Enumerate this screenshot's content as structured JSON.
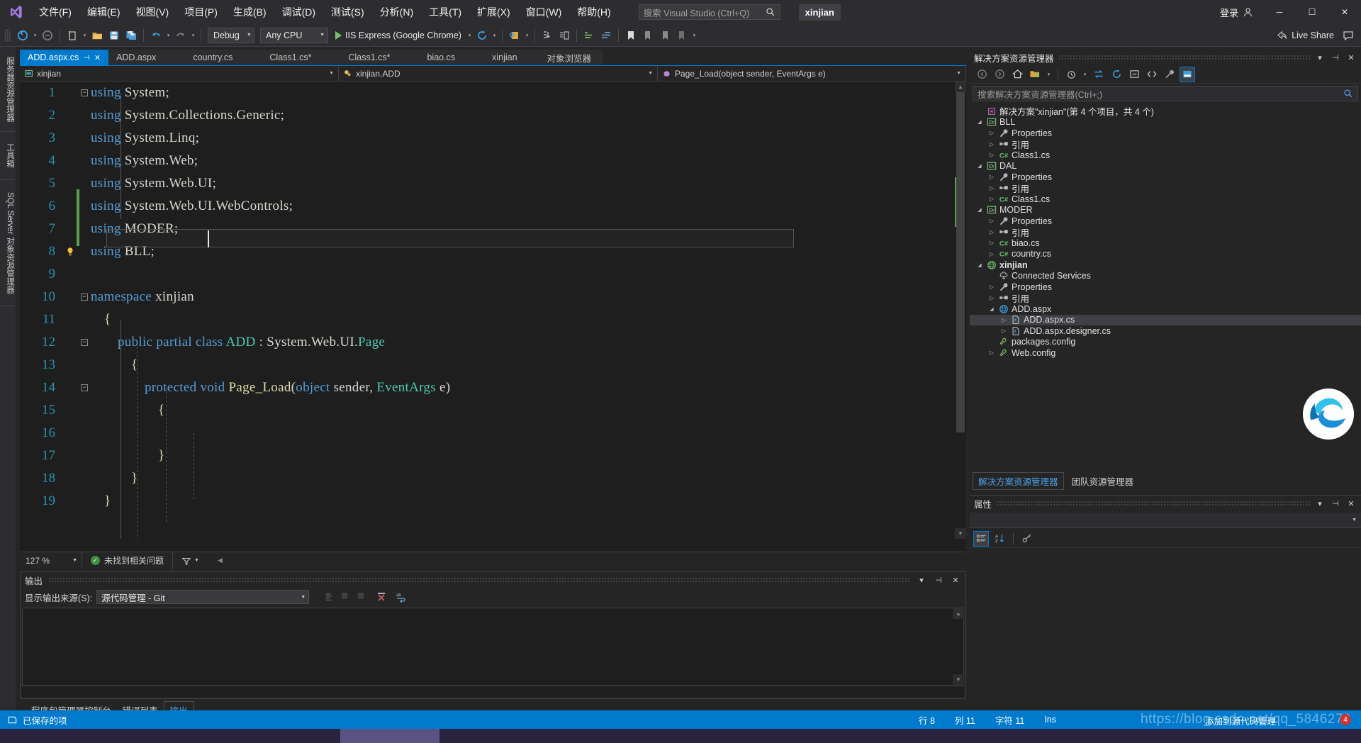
{
  "window": {
    "title": "xinjian",
    "menus": [
      {
        "label": "文件(F)"
      },
      {
        "label": "编辑(E)"
      },
      {
        "label": "视图(V)"
      },
      {
        "label": "项目(P)"
      },
      {
        "label": "生成(B)"
      },
      {
        "label": "调试(D)"
      },
      {
        "label": "测试(S)"
      },
      {
        "label": "分析(N)"
      },
      {
        "label": "工具(T)"
      },
      {
        "label": "扩展(X)"
      },
      {
        "label": "窗口(W)"
      },
      {
        "label": "帮助(H)"
      }
    ],
    "search_placeholder": "搜索 Visual Studio (Ctrl+Q)",
    "signin_label": "登录",
    "minimize": "─",
    "maximize": "☐",
    "close": "✕"
  },
  "toolbar": {
    "config_value": "Debug",
    "platform_value": "Any CPU",
    "run_label": "IIS Express (Google Chrome)",
    "liveshare_label": "Live Share"
  },
  "left_rail": [
    {
      "label": "服务器资源管理器"
    },
    {
      "label": "工具箱"
    },
    {
      "label": "SQL Server 对象资源管理器"
    }
  ],
  "editor": {
    "tabs": [
      {
        "label": "ADD.aspx.cs",
        "active": true,
        "pin": "⊣",
        "close": "✕"
      },
      {
        "label": "ADD.aspx",
        "active": false
      },
      {
        "label": "country.cs",
        "active": false
      },
      {
        "label": "Class1.cs*",
        "active": false
      },
      {
        "label": "Class1.cs*",
        "active": false
      },
      {
        "label": "biao.cs",
        "active": false
      },
      {
        "label": "xinjian",
        "active": false
      },
      {
        "label": "对象浏览器",
        "active": false
      }
    ],
    "nav_project": "xinjian",
    "nav_type": "xinjian.ADD",
    "nav_member": "Page_Load(object sender, EventArgs e)",
    "lines": [
      {
        "n": "1",
        "fold": "minus",
        "indent": 0,
        "tokens": [
          {
            "t": "using",
            "c": "kw"
          },
          {
            "t": " System;",
            "c": "ns"
          }
        ]
      },
      {
        "n": "2",
        "fold": "",
        "indent": 0,
        "tokens": [
          {
            "t": "using",
            "c": "kw"
          },
          {
            "t": " System.Collections.Generic;",
            "c": "ns"
          }
        ]
      },
      {
        "n": "3",
        "fold": "",
        "indent": 0,
        "tokens": [
          {
            "t": "using",
            "c": "kw"
          },
          {
            "t": " System.Linq;",
            "c": "ns"
          }
        ]
      },
      {
        "n": "4",
        "fold": "",
        "indent": 0,
        "tokens": [
          {
            "t": "using",
            "c": "kw"
          },
          {
            "t": " System.Web;",
            "c": "ns"
          }
        ]
      },
      {
        "n": "5",
        "fold": "",
        "indent": 0,
        "tokens": [
          {
            "t": "using",
            "c": "kw"
          },
          {
            "t": " System.Web.UI;",
            "c": "ns"
          }
        ]
      },
      {
        "n": "6",
        "fold": "",
        "indent": 0,
        "tokens": [
          {
            "t": "using",
            "c": "kw"
          },
          {
            "t": " System.Web.UI.WebControls;",
            "c": "ns"
          }
        ]
      },
      {
        "n": "7",
        "fold": "",
        "indent": 0,
        "tokens": [
          {
            "t": "using",
            "c": "kw"
          },
          {
            "t": " MODER;",
            "c": "ns"
          }
        ]
      },
      {
        "n": "8",
        "fold": "",
        "indent": 0,
        "bulb": true,
        "cursorline": true,
        "tokens": [
          {
            "t": "using",
            "c": "kw"
          },
          {
            "t": " BLL;",
            "c": "ns"
          }
        ]
      },
      {
        "n": "9",
        "fold": "",
        "indent": 0,
        "tokens": []
      },
      {
        "n": "10",
        "fold": "minus",
        "indent": 0,
        "tokens": [
          {
            "t": "namespace",
            "c": "kw"
          },
          {
            "t": " xinjian",
            "c": "ns"
          }
        ]
      },
      {
        "n": "11",
        "fold": "",
        "indent": 1,
        "tokens": [
          {
            "t": "{",
            "c": "brace"
          }
        ]
      },
      {
        "n": "12",
        "fold": "minus",
        "indent": 2,
        "tokens": [
          {
            "t": "public ",
            "c": "kw"
          },
          {
            "t": "partial ",
            "c": "kw"
          },
          {
            "t": "class ",
            "c": "kw"
          },
          {
            "t": "ADD",
            "c": "typ"
          },
          {
            "t": " : ",
            "c": "pl"
          },
          {
            "t": "System.Web.UI.",
            "c": "ns"
          },
          {
            "t": "Page",
            "c": "typ"
          }
        ]
      },
      {
        "n": "13",
        "fold": "",
        "indent": 3,
        "tokens": [
          {
            "t": "{",
            "c": "brace"
          }
        ]
      },
      {
        "n": "14",
        "fold": "minus",
        "indent": 4,
        "tokens": [
          {
            "t": "protected ",
            "c": "kw"
          },
          {
            "t": "void ",
            "c": "kw"
          },
          {
            "t": "Page_Load",
            "c": "fn"
          },
          {
            "t": "(",
            "c": "pl"
          },
          {
            "t": "object",
            "c": "kw"
          },
          {
            "t": " sender, ",
            "c": "pl"
          },
          {
            "t": "EventArgs",
            "c": "typ"
          },
          {
            "t": " e)",
            "c": "pl"
          }
        ]
      },
      {
        "n": "15",
        "fold": "",
        "indent": 5,
        "tokens": [
          {
            "t": "{",
            "c": "brace"
          }
        ]
      },
      {
        "n": "16",
        "fold": "",
        "indent": 5,
        "tokens": []
      },
      {
        "n": "17",
        "fold": "",
        "indent": 5,
        "tokens": [
          {
            "t": "}",
            "c": "brace"
          }
        ]
      },
      {
        "n": "18",
        "fold": "",
        "indent": 3,
        "tokens": [
          {
            "t": "}",
            "c": "brace"
          }
        ]
      },
      {
        "n": "19",
        "fold": "",
        "indent": 1,
        "tokens": [
          {
            "t": "}",
            "c": "brace"
          }
        ]
      }
    ],
    "zoom_level": "127 %",
    "issues_label": "未找到相关问题"
  },
  "output": {
    "title": "输出",
    "source_label": "显示输出来源(S):",
    "source_value": "源代码管理 - Git",
    "content": ""
  },
  "bottom_tabs": [
    {
      "label": "程序包管理器控制台",
      "active": false
    },
    {
      "label": "错误列表",
      "active": false
    },
    {
      "label": "输出",
      "active": true
    }
  ],
  "solution_explorer": {
    "title": "解决方案资源管理器",
    "search_placeholder": "搜索解决方案资源管理器(Ctrl+;)",
    "tree": [
      {
        "depth": 0,
        "arrow": "",
        "icon": "solution",
        "label": "解决方案\"xinjian\"(第 4 个项目，共 4 个)",
        "bold": false,
        "selected": false
      },
      {
        "depth": 0,
        "arrow": "down",
        "icon": "csproj",
        "label": "BLL",
        "bold": false,
        "selected": false
      },
      {
        "depth": 1,
        "arrow": "right",
        "icon": "wrench",
        "label": "Properties",
        "bold": false,
        "selected": false
      },
      {
        "depth": 1,
        "arrow": "right",
        "icon": "refs",
        "label": "引用",
        "bold": false,
        "selected": false
      },
      {
        "depth": 1,
        "arrow": "right",
        "icon": "cs",
        "label": "Class1.cs",
        "bold": false,
        "selected": false
      },
      {
        "depth": 0,
        "arrow": "down",
        "icon": "csproj",
        "label": "DAL",
        "bold": false,
        "selected": false
      },
      {
        "depth": 1,
        "arrow": "right",
        "icon": "wrench",
        "label": "Properties",
        "bold": false,
        "selected": false
      },
      {
        "depth": 1,
        "arrow": "right",
        "icon": "refs",
        "label": "引用",
        "bold": false,
        "selected": false
      },
      {
        "depth": 1,
        "arrow": "right",
        "icon": "cs",
        "label": "Class1.cs",
        "bold": false,
        "selected": false
      },
      {
        "depth": 0,
        "arrow": "down",
        "icon": "csproj",
        "label": "MODER",
        "bold": false,
        "selected": false
      },
      {
        "depth": 1,
        "arrow": "right",
        "icon": "wrench",
        "label": "Properties",
        "bold": false,
        "selected": false
      },
      {
        "depth": 1,
        "arrow": "right",
        "icon": "refs",
        "label": "引用",
        "bold": false,
        "selected": false
      },
      {
        "depth": 1,
        "arrow": "right",
        "icon": "cs",
        "label": "biao.cs",
        "bold": false,
        "selected": false
      },
      {
        "depth": 1,
        "arrow": "right",
        "icon": "cs",
        "label": "country.cs",
        "bold": false,
        "selected": false
      },
      {
        "depth": 0,
        "arrow": "down",
        "icon": "web",
        "label": "xinjian",
        "bold": true,
        "selected": false
      },
      {
        "depth": 1,
        "arrow": "",
        "icon": "cloud",
        "label": "Connected Services",
        "bold": false,
        "selected": false
      },
      {
        "depth": 1,
        "arrow": "right",
        "icon": "wrench",
        "label": "Properties",
        "bold": false,
        "selected": false
      },
      {
        "depth": 1,
        "arrow": "right",
        "icon": "refs",
        "label": "引用",
        "bold": false,
        "selected": false
      },
      {
        "depth": 1,
        "arrow": "down",
        "icon": "webpage",
        "label": "ADD.aspx",
        "bold": false,
        "selected": false
      },
      {
        "depth": 2,
        "arrow": "right",
        "icon": "codefile",
        "label": "ADD.aspx.cs",
        "bold": false,
        "selected": true
      },
      {
        "depth": 2,
        "arrow": "right",
        "icon": "codefile",
        "label": "ADD.aspx.designer.cs",
        "bold": false,
        "selected": false
      },
      {
        "depth": 1,
        "arrow": "",
        "icon": "config",
        "label": "packages.config",
        "bold": false,
        "selected": false
      },
      {
        "depth": 1,
        "arrow": "right",
        "icon": "config",
        "label": "Web.config",
        "bold": false,
        "selected": false
      }
    ],
    "tabs": [
      {
        "label": "解决方案资源管理器",
        "active": true
      },
      {
        "label": "团队资源管理器",
        "active": false
      }
    ]
  },
  "properties": {
    "title": "属性",
    "selected_object": ""
  },
  "statusbar": {
    "message": "已保存的项",
    "line": "行 8",
    "column": "列 11",
    "character": "字符 11",
    "insert_mode": "Ins",
    "source_control": "添加到源代码管理",
    "watermark": "https://blog.csdn.net/qq_5846270",
    "badge": "4"
  },
  "colors": {
    "accent": "#007acc",
    "titlebar_bg": "#2d2d30",
    "editor_bg": "#1e1e1e",
    "panel_bg": "#252526",
    "keyword": "#569cd6",
    "type": "#4ec9b0",
    "method": "#dcdcaa",
    "linenum": "#2b91af",
    "status_bg": "#007acc"
  }
}
